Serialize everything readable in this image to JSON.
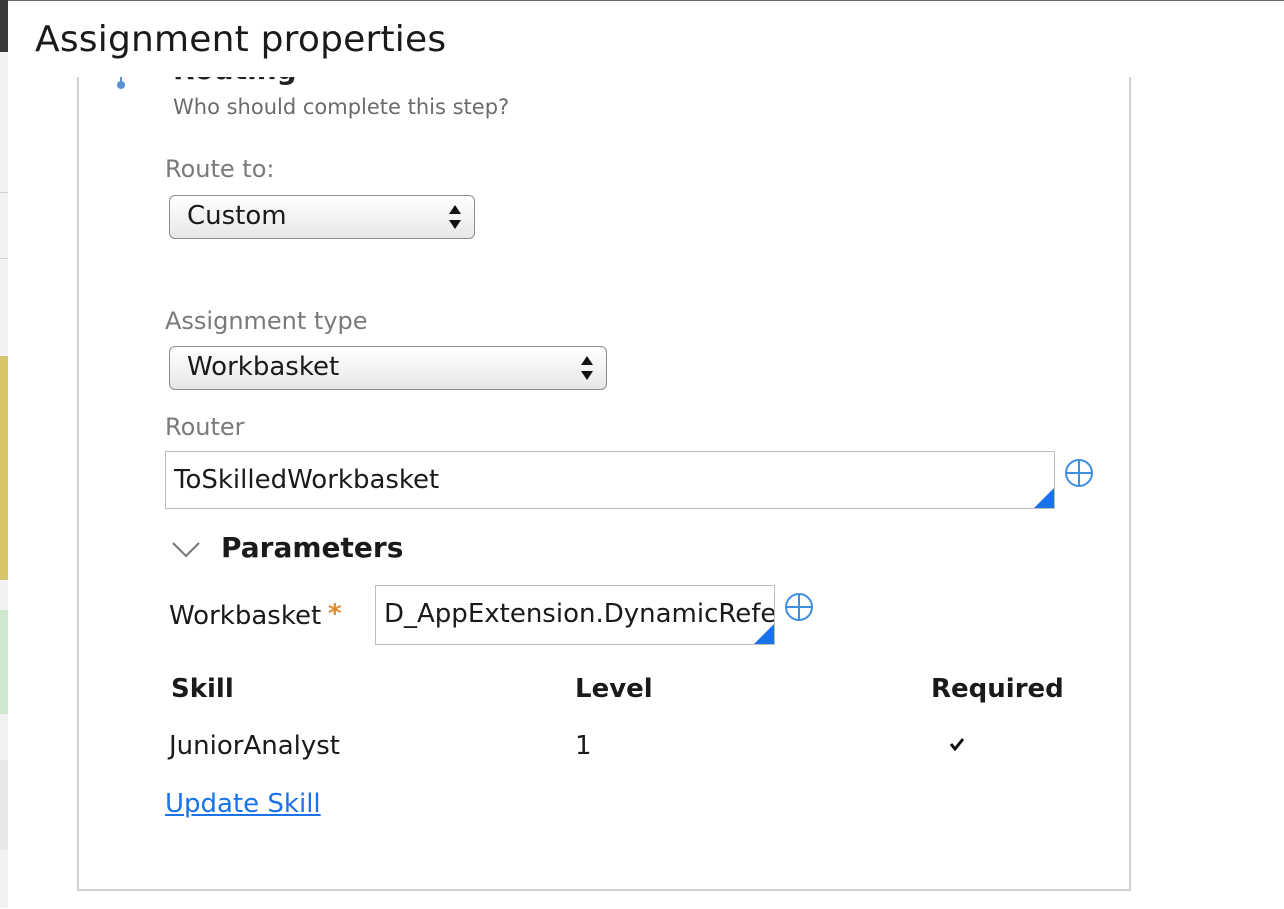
{
  "modal": {
    "title": "Assignment properties"
  },
  "routing": {
    "heading": "Routing",
    "subtitle": "Who should complete this step?",
    "route_to": {
      "label": "Route to:",
      "selected": "Custom"
    },
    "assignment_type": {
      "label": "Assignment type",
      "selected": "Workbasket"
    },
    "router": {
      "label": "Router",
      "value": "ToSkilledWorkbasket"
    }
  },
  "parameters": {
    "title": "Parameters",
    "workbasket": {
      "label": "Workbasket",
      "required_marker": "*",
      "value": "D_AppExtension.DynamicReference"
    },
    "skills_table": {
      "headers": {
        "skill": "Skill",
        "level": "Level",
        "required": "Required"
      },
      "rows": [
        {
          "skill": "JuniorAnalyst",
          "level": "1",
          "required": true
        }
      ]
    },
    "update_link": "Update Skill"
  },
  "icons": {
    "routing": "routing-icon",
    "select_arrows": "updown-arrows-icon",
    "lookup": "crosshair-icon",
    "collapse": "chevron-down-icon",
    "check": "check-icon"
  },
  "colors": {
    "link": "#1a73e8",
    "required_star": "#e08a2c",
    "input_corner": "#1a73e8"
  }
}
